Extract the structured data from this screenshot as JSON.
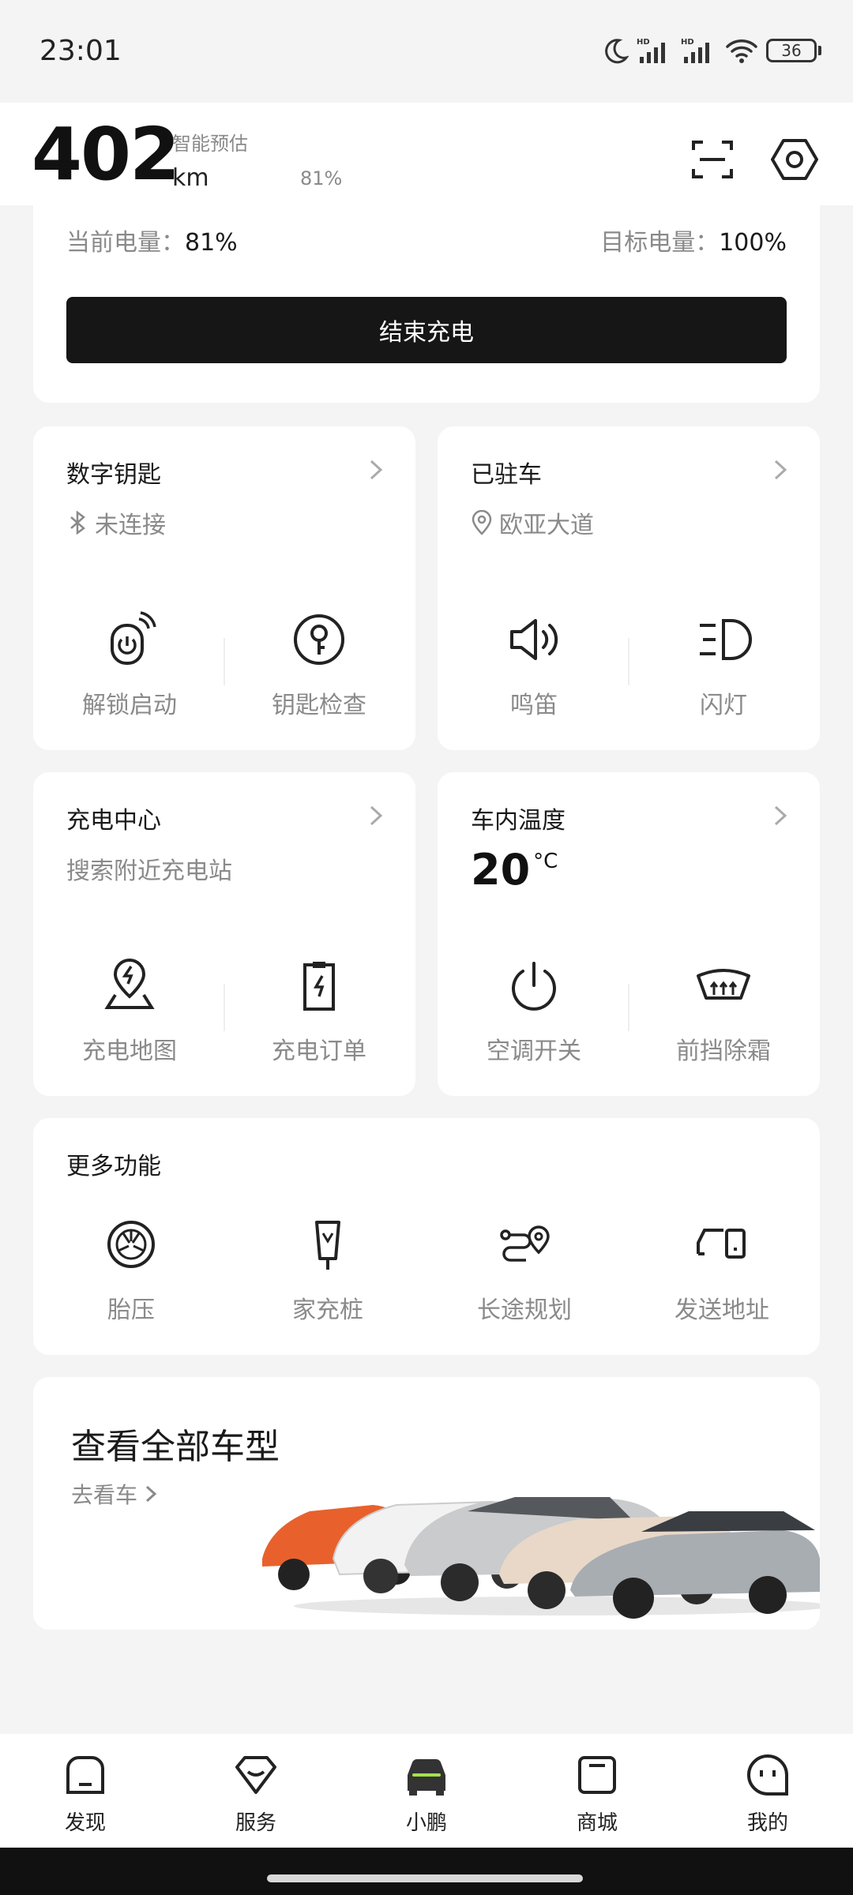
{
  "status_bar": {
    "time": "23:01",
    "battery": "36"
  },
  "header": {
    "range_value": "402",
    "range_unit": "km",
    "range_note": "智能预估",
    "battery_percent": "81%"
  },
  "charging": {
    "current_label": "当前电量：",
    "current_value": "81%",
    "target_label": "目标电量：",
    "target_value": "100%",
    "end_button": "结束充电"
  },
  "digital_key": {
    "title": "数字钥匙",
    "status": "未连接",
    "actions": [
      "解锁启动",
      "钥匙检查"
    ]
  },
  "parked": {
    "title": "已驻车",
    "location": "欧亚大道",
    "actions": [
      "鸣笛",
      "闪灯"
    ]
  },
  "charge_center": {
    "title": "充电中心",
    "subtitle": "搜索附近充电站",
    "actions": [
      "充电地图",
      "充电订单"
    ]
  },
  "cabin_temp": {
    "title": "车内温度",
    "value": "20",
    "unit": "°C",
    "actions": [
      "空调开关",
      "前挡除霜"
    ]
  },
  "more": {
    "title": "更多功能",
    "items": [
      "胎压",
      "家充桩",
      "长途规划",
      "发送地址"
    ]
  },
  "models": {
    "title": "查看全部车型",
    "link": "去看车"
  },
  "bottom_nav": {
    "items": [
      "发现",
      "服务",
      "小鹏",
      "商城",
      "我的"
    ],
    "active_index": 2,
    "accent": "#a4e34b"
  }
}
